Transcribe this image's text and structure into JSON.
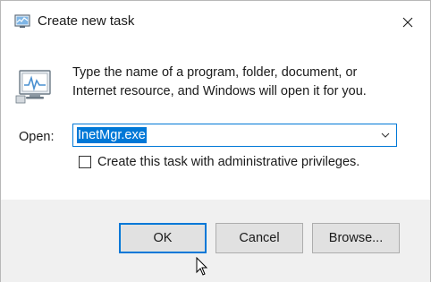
{
  "window": {
    "title": "Create new task",
    "close_icon": "close-icon",
    "title_icon": "task-run-icon"
  },
  "body": {
    "icon": "run-program-icon",
    "description": "Type the name of a program, folder, document, or\nInternet resource, and Windows will open it for you.",
    "open_label": "Open:",
    "open_value": "InetMgr.exe",
    "checkbox_label": "Create this task with administrative privileges.",
    "checkbox_checked": false
  },
  "footer": {
    "ok_label": "OK",
    "cancel_label": "Cancel",
    "browse_label": "Browse..."
  },
  "colors": {
    "accent": "#0078d7",
    "footer_bg": "#f0f0f0",
    "button_bg": "#e1e1e1"
  }
}
